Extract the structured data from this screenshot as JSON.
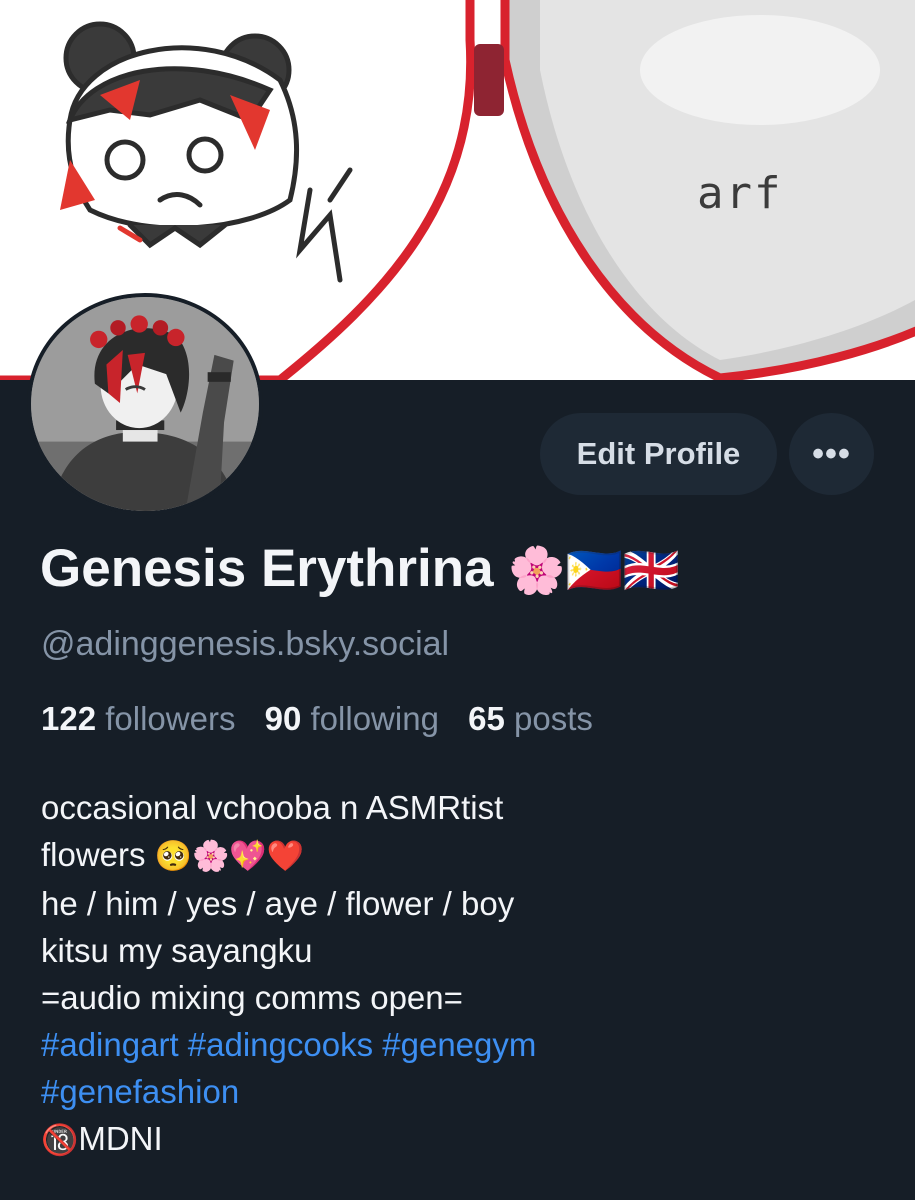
{
  "banner": {
    "caption": "arf",
    "colors": {
      "heart_rim": "#d8222d",
      "background": "#ffffff",
      "hair_red": "#e2372f"
    }
  },
  "profile": {
    "display_name": "Genesis Erythrina",
    "name_emojis": "🌸🇵🇭🇬🇧",
    "handle": "@adinggenesis.bsky.social"
  },
  "actions": {
    "edit_label": "Edit Profile",
    "more_label": "•••"
  },
  "stats": {
    "followers_count": "122",
    "followers_label": "followers",
    "following_count": "90",
    "following_label": "following",
    "posts_count": "65",
    "posts_label": "posts"
  },
  "bio": {
    "line1": "occasional vchooba n ASMRtist",
    "line2_text": "flowers",
    "line2_emojis": "🥺🌸💖❤️",
    "line3": "he / him / yes / aye / flower / boy",
    "line4": "kitsu my sayangku",
    "line5": "=audio mixing comms open=",
    "hashtags": [
      "#adingart",
      "#adingcooks",
      "#genegym",
      "#genefashion"
    ],
    "last_emoji": "🔞",
    "last_text": "MDNI"
  },
  "theme": {
    "background": "#161e27",
    "button_bg": "#1e2935",
    "text_primary": "#f3f5f8",
    "text_secondary": "#8594a7",
    "link": "#3d8ff2"
  }
}
